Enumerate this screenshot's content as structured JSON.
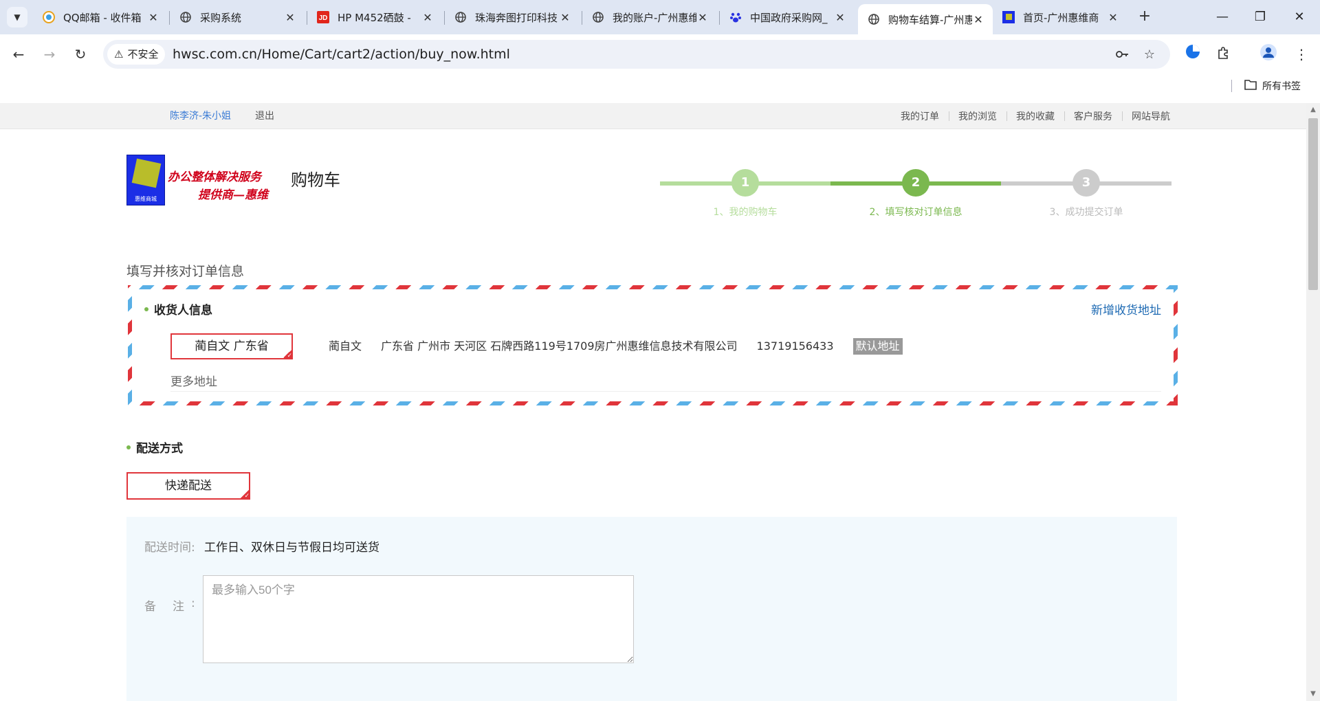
{
  "browser": {
    "tabs": [
      {
        "title": "QQ邮箱 - 收件箱",
        "favicon": "qq-mail-icon"
      },
      {
        "title": "采购系统",
        "favicon": "globe-icon"
      },
      {
        "title": "HP M452硒鼓 -",
        "favicon": "jd-icon"
      },
      {
        "title": "珠海奔图打印科技",
        "favicon": "globe-icon"
      },
      {
        "title": "我的账户-广州惠维",
        "favicon": "globe-icon"
      },
      {
        "title": "中国政府采购网_",
        "favicon": "paw-icon"
      },
      {
        "title": "购物车结算-广州惠维",
        "favicon": "globe-icon",
        "active": true
      },
      {
        "title": "首页-广州惠维商",
        "favicon": "site-icon"
      }
    ],
    "security_label": "不安全",
    "url": "hwsc.com.cn/Home/Cart/cart2/action/buy_now.html",
    "bookmarks_all_label": "所有书签"
  },
  "topbar": {
    "user": "陈李济-朱小姐",
    "logout": "退出",
    "nav": [
      "我的订单",
      "我的浏览",
      "我的收藏",
      "客户服务",
      "网站导航"
    ]
  },
  "header": {
    "logo_line1": "办公整体解决服务",
    "logo_line2": "提供商—惠维",
    "logo_mark_text": "惠维商城",
    "title": "购物车"
  },
  "steps": [
    {
      "number": "1",
      "label": "1、我的购物车",
      "state": "done"
    },
    {
      "number": "2",
      "label": "2、填写核对订单信息",
      "state": "active"
    },
    {
      "number": "3",
      "label": "3、成功提交订单",
      "state": "todo"
    }
  ],
  "main": {
    "section_title": "填写并核对订单信息",
    "consignee": {
      "heading": "收货人信息",
      "add_address": "新增收货地址",
      "selected_chip": "蔺自文 广东省",
      "name": "蔺自文",
      "address": "广东省 广州市 天河区 石牌西路119号1709房广州惠维信息技术有限公司",
      "phone": "13719156433",
      "default_badge": "默认地址",
      "more": "更多地址"
    },
    "shipping": {
      "heading": "配送方式",
      "method": "快递配送",
      "time_label": "配送时间:",
      "time_value": "工作日、双休日与节假日均可送货",
      "note_label": "备注",
      "note_colon": ":",
      "note_placeholder": "最多输入50个字",
      "note_value": ""
    }
  },
  "colors": {
    "accent_red": "#e0353b",
    "step_green": "#7bb84f",
    "step_light_green": "#b5dd9c",
    "step_grey": "#cccccc",
    "link_blue": "#1e6ab3",
    "panel_bg": "#f2f9fd"
  }
}
